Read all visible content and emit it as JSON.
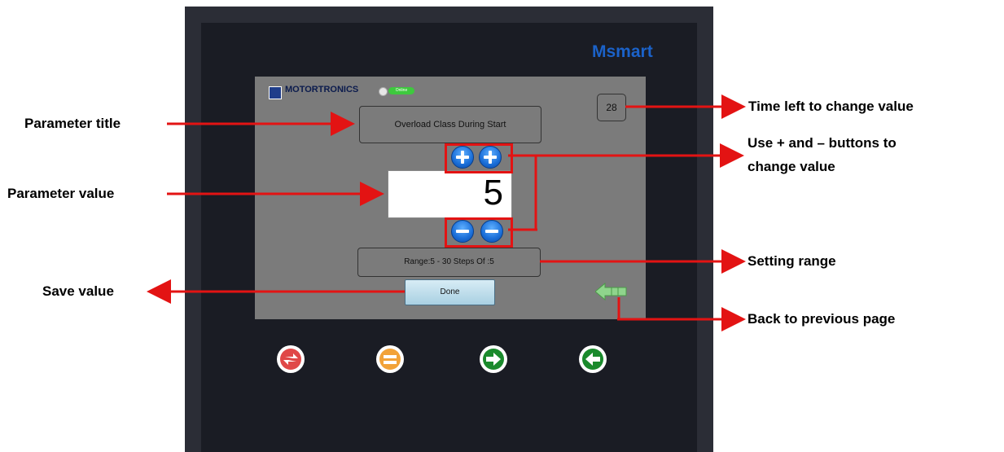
{
  "device": {
    "brand": "Msmart"
  },
  "screen": {
    "logo_text": "MOTORTRONICS",
    "online_label": "Online",
    "timer": "28",
    "parameter_title": "Overload Class During Start",
    "parameter_value": "5",
    "range_text": "Range:5 - 30   Steps Of  :5",
    "done_label": "Done"
  },
  "icons": {
    "plus": "plus-icon",
    "minus": "minus-icon",
    "back": "back-arrow-icon",
    "hardware": [
      "swap-icon",
      "equals-icon",
      "right-arrow-icon",
      "left-arrow-icon"
    ]
  },
  "annotations": {
    "parameter_title": "Parameter title",
    "parameter_value": "Parameter value",
    "save_value": "Save value",
    "time_left": "Time left to change value",
    "plus_minus_line1": "Use + and – buttons to",
    "plus_minus_line2": "change value",
    "setting_range": "Setting range",
    "back_page": "Back to previous page"
  },
  "colors": {
    "annotation_red": "#e31313",
    "brand_blue": "#1b62c9",
    "screen_gray": "#7b7b7b",
    "button_blue": "#1a6ed8"
  }
}
